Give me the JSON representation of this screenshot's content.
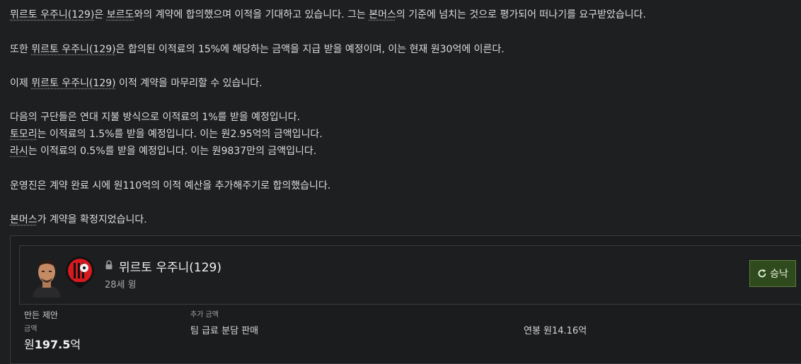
{
  "news": {
    "p1": {
      "player": "뮈르토 우주니(129)",
      "mid": "은 ",
      "club": "보르도",
      "rest": "와의 계약에 합의했으며 이적을 기대하고 있습니다. 그는 ",
      "club2": "본머스",
      "end": "의 기준에 넘치는 것으로 평가되어 떠나기를 요구받았습니다."
    },
    "p2": {
      "pre": "또한 ",
      "player": "뮈르토 우주니(129)",
      "rest": "은 합의된 이적료의 15%에 해당하는 금액을 지급 받을 예정이며, 이는 현재 원30억에 이른다."
    },
    "p3": {
      "pre": "이제 ",
      "player": "뮈르토 우주니(129)",
      "rest": " 이적 계약을 마무리할 수 있습니다."
    },
    "p4": {
      "line1": "다음의 구단들은 연대 지불 방식으로 이적료의 1%를 받을 예정입니다.",
      "club_a": "토모리",
      "line2": "는 이적료의 1.5%를 받을 예정입니다. 이는 원2.95억의 금액입니다.",
      "club_b": "라시",
      "line3": "는 이적료의 0.5%를 받을 예정입니다. 이는 원9837만의 금액입니다."
    },
    "p5": "운영진은 계약 완료 시에 원110억의 이적 예산을 추가해주기로 합의했습니다.",
    "p6": {
      "club": "본머스",
      "rest": "가 계약을 확정지었습니다."
    }
  },
  "card": {
    "player_name": "뮈르토 우주니(129)",
    "player_sub": "28세 윙",
    "accept_label": "승낙",
    "offer_label": "만든 제안",
    "amount_label": "금액",
    "fee_prefix": "원",
    "fee_value": "197.5",
    "fee_suffix": "억",
    "extra_label": "추가 금액",
    "extra_value": "팀 급료 분담 판매",
    "salary": "연봉 원14.16억"
  },
  "colors": {
    "accept_bg": "#2f4a1c",
    "crest_red": "#d71920",
    "background": "#1e1f21"
  }
}
